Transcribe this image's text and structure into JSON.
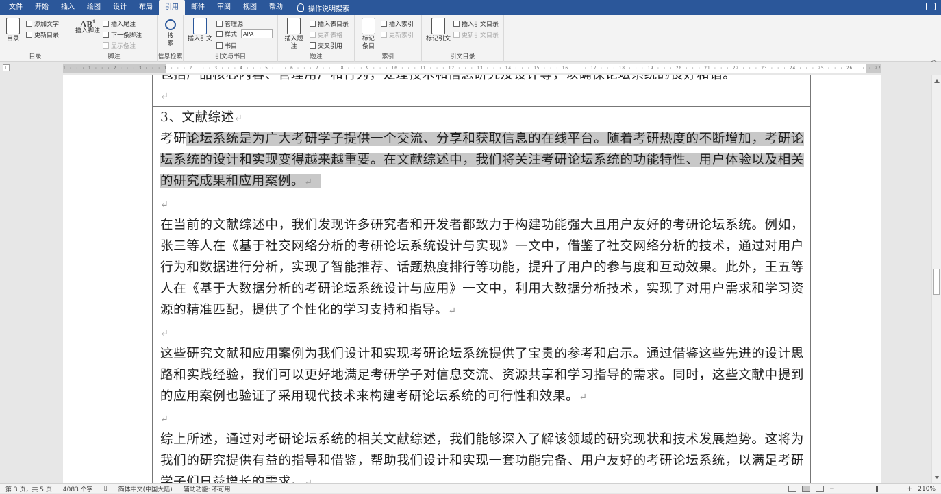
{
  "tabs": [
    "文件",
    "开始",
    "插入",
    "绘图",
    "设计",
    "布局",
    "引用",
    "邮件",
    "审阅",
    "视图",
    "帮助"
  ],
  "active_tab_index": 6,
  "tell_me": "操作说明搜索",
  "ribbon": {
    "toc": {
      "big": "目录",
      "add_text": "添加文字",
      "update": "更新目录",
      "label": "目录"
    },
    "footnotes": {
      "big": "插入脚注",
      "insert_endnote": "插入尾注",
      "next_footnote": "下一条脚注",
      "show_notes": "显示备注",
      "label": "脚注"
    },
    "research": {
      "big": "搜索",
      "label": "信息检索"
    },
    "citations": {
      "big": "插入引文",
      "manage": "管理源",
      "style_label": "样式:",
      "style_value": "APA",
      "bibliography": "书目",
      "label": "引文与书目"
    },
    "captions": {
      "big": "插入题注",
      "insert_tof": "插入表目录",
      "update_table": "更新表格",
      "cross_ref": "交叉引用",
      "label": "题注"
    },
    "index": {
      "big": "标记条目",
      "insert_index": "插入索引",
      "update_index": "更新索引",
      "label": "索引"
    },
    "toa": {
      "big": "标记引文",
      "insert_toa": "插入引文目录",
      "update_toa": "更新引文目录",
      "label": "引文目录"
    }
  },
  "ruler": {
    "tab_glyph": "L",
    "ticks": "1 · · · 1 · · · 2 · · · 3 · · · 1 · · · 2 · · · 3 · · · 4 · · · 5 · · · 6 · · · 7 · · · 8 · · · 9 · · · 10 · · · 11 · · · 12 · · · 13 · · · 14 · · · 15 · · · 16 · · · 17 · · · 18 · · · 19 · · · 20 · · · 21 · · · 22 · · · 23 · · · 24 · · · 25 · · · 26 · · · 27 · · · 28 · · · 29 · · · 30 · · · 31 · · · 32 · · · 33 · · · 34 · · · 35 · · · 36 · · · 37 · · · 38 · · · 39 · · · 40 · · · 41 · · · 42 · · · 43 · · · 44 · · · 45 · · · 46 · · · 47 · · · 48 · · · 49"
  },
  "document": {
    "top_partial": "包括产品核心内容、管理用户和行为，处理技术和信息研究及设计等，以确保论坛系统的良好和谐。",
    "heading": "3、文献综述",
    "p1_prefix": "考研",
    "p1_highlight": "论坛系统是为广大考研学子提供一个交流、分享和获取信息的在线平台。随着考研热度的不断增加，考研论坛系统的设计和实现变得越来越重要。在文献综述中，我们将关注考研论坛系统的功能特性、用户体验以及相关的研究成果和应用案例。",
    "p2": "在当前的文献综述中，我们发现许多研究者和开发者都致力于构建功能强大且用户友好的考研论坛系统。例如，张三等人在《基于社交网络分析的考研论坛系统设计与实现》一文中，借鉴了社交网络分析的技术，通过对用户行为和数据进行分析，实现了智能推荐、话题热度排行等功能，提升了用户的参与度和互动效果。此外，王五等人在《基于大数据分析的考研论坛系统设计与应用》一文中，利用大数据分析技术，实现了对用户需求和学习资源的精准匹配，提供了个性化的学习支持和指导。",
    "p3": "这些研究文献和应用案例为我们设计和实现考研论坛系统提供了宝贵的参考和启示。通过借鉴这些先进的设计思路和实践经验，我们可以更好地满足考研学子对信息交流、资源共享和学习指导的需求。同时，这些文献中提到的应用案例也验证了采用现代技术来构建考研论坛系统的可行性和效果。",
    "p4": "综上所述，通过对考研论坛系统的相关文献综述，我们能够深入了解该领域的研究现状和技术发展趋势。这将为我们的研究提供有益的指导和借鉴，帮助我们设计和实现一套功能完备、用户友好的考研论坛系统，以满足考研学子们日益增长的需求。",
    "para_mark": "↵"
  },
  "status": {
    "page": "第 3 页，共 5 页",
    "words": "4083 个字",
    "language": "简体中文(中国大陆)",
    "accessibility": "辅助功能: 不可用",
    "zoom": "210%",
    "zoom_minus": "−",
    "zoom_plus": "+"
  }
}
